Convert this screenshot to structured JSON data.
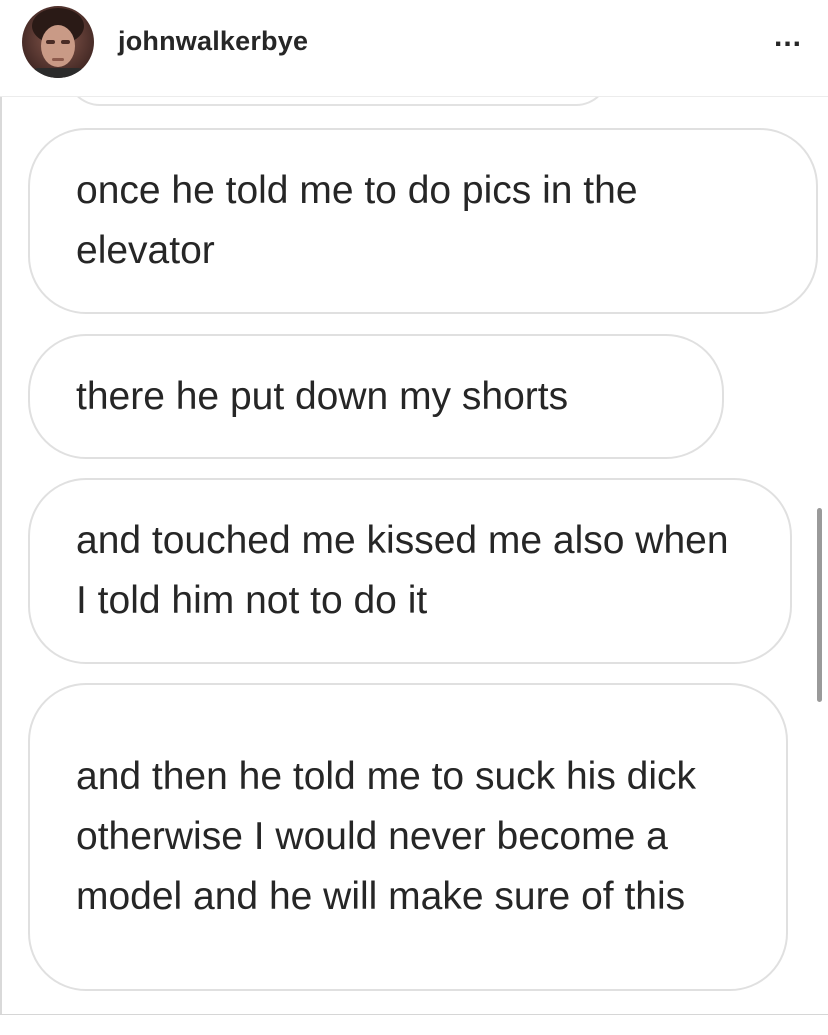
{
  "header": {
    "username": "johnwalkerbye",
    "more_label": "..."
  },
  "messages": [
    {
      "text": "once he told me to do pics in the elevator"
    },
    {
      "text": "there he put down my shorts"
    },
    {
      "text": "and touched me kissed me also when I told him not to do it"
    },
    {
      "text": "and then he told me to suck his dick otherwise I would never become a model and he will make sure of this"
    }
  ],
  "colors": {
    "text": "#262626",
    "bubble_border": "#e0e0e0",
    "background": "#ffffff",
    "scrollbar": "#9a9a9a"
  },
  "icons": {
    "avatar": "profile-photo",
    "more": "more-options-icon"
  }
}
